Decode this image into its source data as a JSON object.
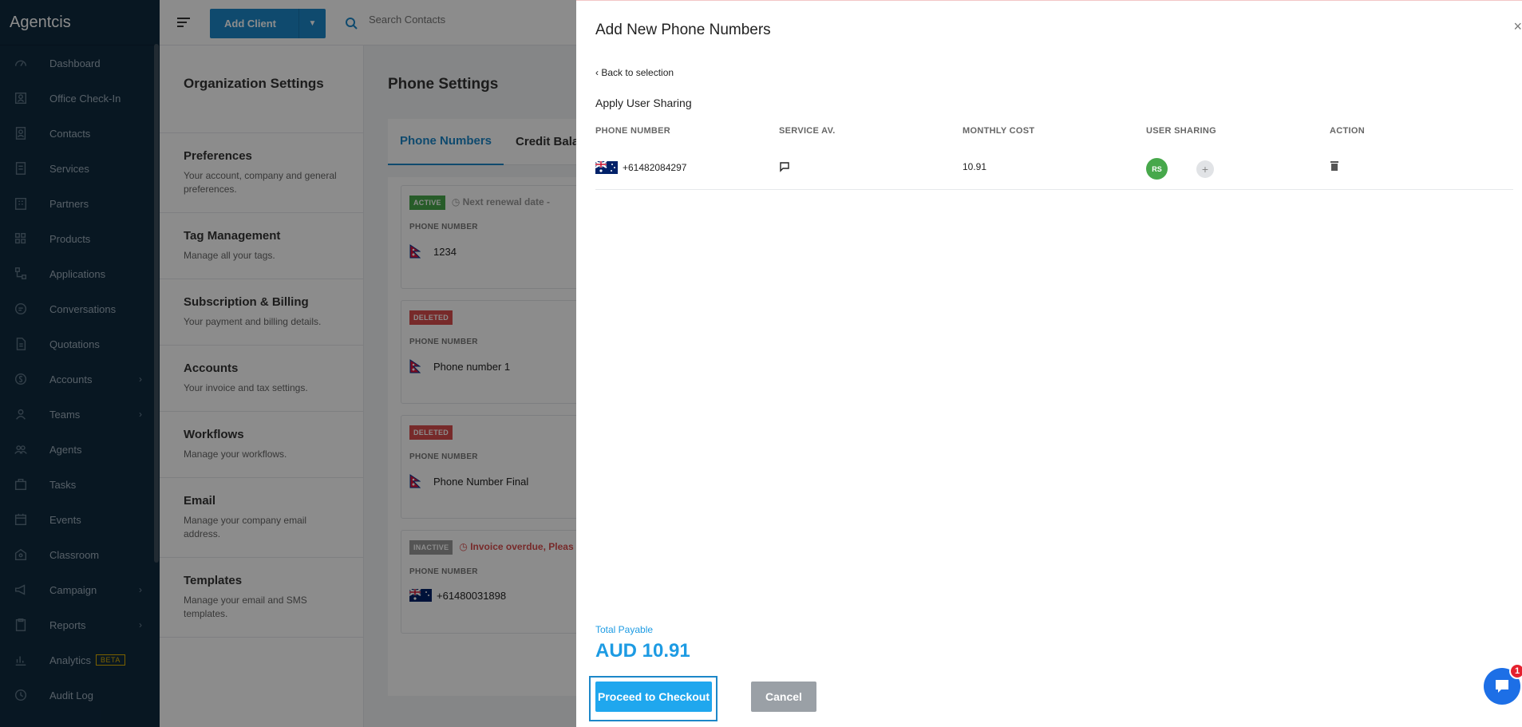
{
  "app": {
    "brand": "Agentcis"
  },
  "sidebar": {
    "items": [
      {
        "label": "Dashboard",
        "icon": "gauge-icon",
        "chevron": false
      },
      {
        "label": "Office Check-In",
        "icon": "checkin-icon",
        "chevron": false
      },
      {
        "label": "Contacts",
        "icon": "contacts-icon",
        "chevron": false
      },
      {
        "label": "Services",
        "icon": "services-icon",
        "chevron": false
      },
      {
        "label": "Partners",
        "icon": "building-icon",
        "chevron": false
      },
      {
        "label": "Products",
        "icon": "grid-icon",
        "chevron": false
      },
      {
        "label": "Applications",
        "icon": "flow-icon",
        "chevron": false
      },
      {
        "label": "Conversations",
        "icon": "chat-icon",
        "chevron": false
      },
      {
        "label": "Quotations",
        "icon": "document-icon",
        "chevron": false
      },
      {
        "label": "Accounts",
        "icon": "dollar-icon",
        "chevron": true
      },
      {
        "label": "Teams",
        "icon": "user-icon",
        "chevron": true
      },
      {
        "label": "Agents",
        "icon": "users-icon",
        "chevron": false
      },
      {
        "label": "Tasks",
        "icon": "briefcase-icon",
        "chevron": false
      },
      {
        "label": "Events",
        "icon": "calendar-icon",
        "chevron": false
      },
      {
        "label": "Classroom",
        "icon": "classroom-icon",
        "chevron": false
      },
      {
        "label": "Campaign",
        "icon": "megaphone-icon",
        "chevron": true
      },
      {
        "label": "Reports",
        "icon": "clipboard-icon",
        "chevron": true
      },
      {
        "label": "Analytics",
        "icon": "chart-icon",
        "chevron": false,
        "badge": "BETA"
      },
      {
        "label": "Audit Log",
        "icon": "history-icon",
        "chevron": false
      }
    ]
  },
  "topbar": {
    "add_client": "Add Client",
    "search_placeholder": "Search Contacts"
  },
  "org": {
    "title": "Organization Settings",
    "items": [
      {
        "title": "Preferences",
        "desc": "Your account, company and general preferences."
      },
      {
        "title": "Tag Management",
        "desc": "Manage all your tags."
      },
      {
        "title": "Subscription & Billing",
        "desc": "Your payment and billing details."
      },
      {
        "title": "Accounts",
        "desc": "Your invoice and tax settings."
      },
      {
        "title": "Workflows",
        "desc": "Manage your workflows."
      },
      {
        "title": "Email",
        "desc": "Manage your company email address."
      },
      {
        "title": "Templates",
        "desc": "Manage your email and SMS templates."
      }
    ]
  },
  "phone_settings": {
    "title": "Phone Settings",
    "tabs": [
      "Phone Numbers",
      "Credit Balan"
    ],
    "cards": [
      {
        "status": "ACTIVE",
        "note": "Next renewal date -",
        "label": "PHONE NUMBER",
        "number": "1234",
        "flag": "nepal"
      },
      {
        "status": "DELETED",
        "note": "",
        "label": "PHONE NUMBER",
        "number": "Phone number 1",
        "flag": "nepal"
      },
      {
        "status": "DELETED",
        "note": "",
        "label": "PHONE NUMBER",
        "number": "Phone Number Final",
        "flag": "nepal"
      },
      {
        "status": "INACTIVE",
        "note": "Invoice overdue, Pleas",
        "label": "PHONE NUMBER",
        "number": "+61480031898",
        "flag": "australia"
      }
    ]
  },
  "drawer": {
    "title": "Add New Phone Numbers",
    "close": "×",
    "back": "Back to selection",
    "apply": "Apply User Sharing",
    "columns": [
      "PHONE NUMBER",
      "SERVICE AV.",
      "MONTHLY COST",
      "USER SHARING",
      "ACTION"
    ],
    "row": {
      "number": "+61482084297",
      "cost": "10.91",
      "avatar": "RS"
    },
    "total_label": "Total Payable",
    "total_value": "AUD 10.91",
    "checkout": "Proceed to Checkout",
    "cancel": "Cancel",
    "chat_badge": "1"
  }
}
